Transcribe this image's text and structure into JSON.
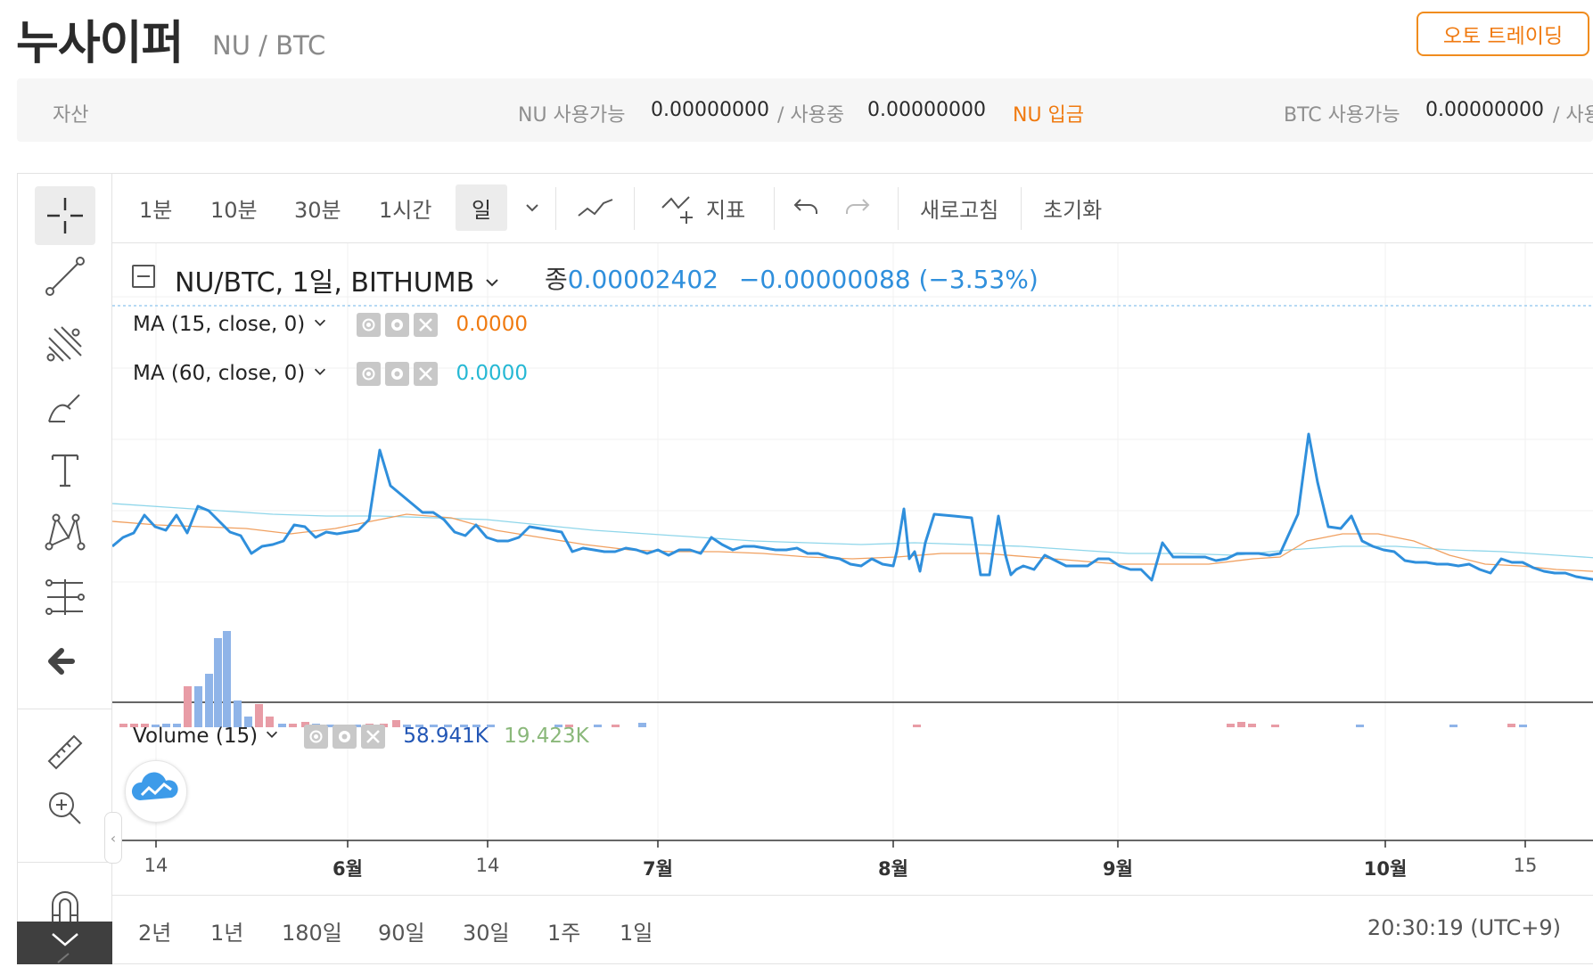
{
  "header": {
    "coin_name": "누사이퍼",
    "pair": "NU / BTC",
    "auto_trade_label": "오토 트레이딩"
  },
  "asset_bar": {
    "label": "자산",
    "base_available_label": "NU 사용가능",
    "base_available_value": "0.00000000",
    "in_use_label": "/ 사용중",
    "base_in_use_value": "0.00000000",
    "deposit_label": "NU 입금",
    "quote_available_label": "BTC 사용가능",
    "quote_available_value": "0.00000000",
    "quote_in_use_label": "/ 사용"
  },
  "toolbar": {
    "intervals": [
      "1분",
      "10분",
      "30분",
      "1시간",
      "일"
    ],
    "active_interval": "일",
    "indicator_label": "지표",
    "refresh_label": "새로고침",
    "reset_label": "초기화"
  },
  "legend": {
    "symbol": "NU/BTC, 1일, BITHUMB",
    "close_prefix": "종",
    "close_value": "0.00002402",
    "change_value": "−0.00000088 (−3.53%)",
    "ma15_label": "MA (15, close, 0)",
    "ma15_value": "0.0000",
    "ma60_label": "MA (60, close, 0)",
    "ma60_value": "0.0000",
    "volume_label": "Volume (15)",
    "volume_value": "58.941K",
    "volume_ma_value": "19.423K"
  },
  "x_axis_labels": [
    "14",
    "6월",
    "14",
    "7월",
    "8월",
    "9월",
    "10월",
    "15"
  ],
  "range_buttons": [
    "2년",
    "1년",
    "180일",
    "90일",
    "30일",
    "1주",
    "1일"
  ],
  "timestamp": "20:30:19 (UTC+9)",
  "colors": {
    "price_line": "#2f8fdc",
    "ma15": "#f0a060",
    "ma60": "#8fd6ea",
    "volume_up": "#8fb4e8",
    "volume_down": "#e89ca6",
    "accent": "#f07a10",
    "positive_legend": "#2f8fdc",
    "ma15_legend": "#f07a10",
    "ma60_legend": "#26b8d4",
    "volume_legend": "#2256b5",
    "volume_ma_legend": "#8ab87a"
  }
}
